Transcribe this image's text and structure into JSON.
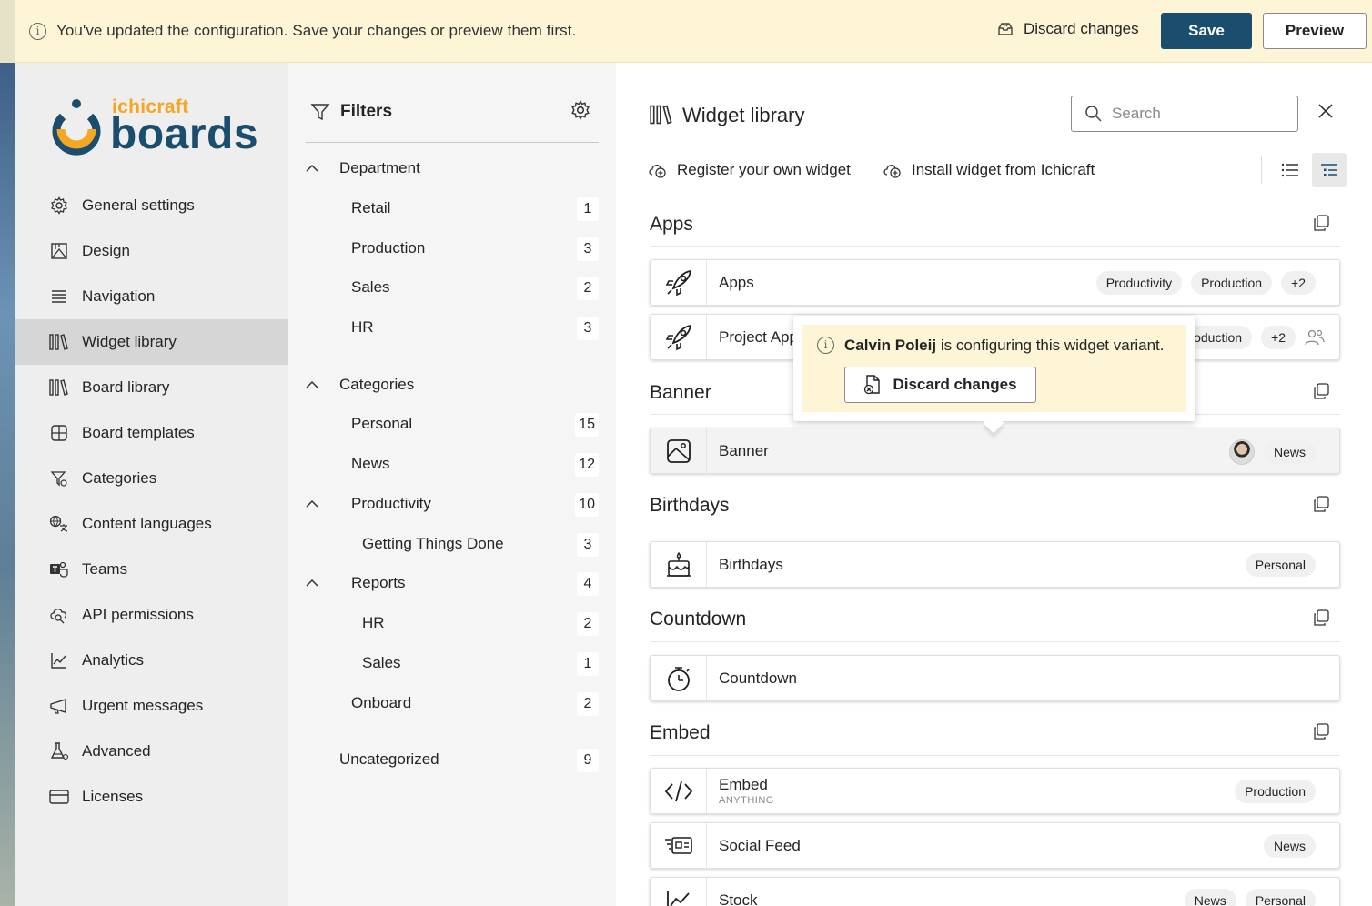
{
  "banner": {
    "message": "You've updated the configuration. Save your changes or preview them first.",
    "discard_label": "Discard changes",
    "save_label": "Save",
    "preview_label": "Preview"
  },
  "logo": {
    "small": "ichicraft",
    "big": "boards"
  },
  "sidebar": {
    "items": [
      {
        "label": "General settings",
        "icon": "gear-icon"
      },
      {
        "label": "Design",
        "icon": "design-icon"
      },
      {
        "label": "Navigation",
        "icon": "menu-icon"
      },
      {
        "label": "Widget library",
        "icon": "library-icon",
        "active": true
      },
      {
        "label": "Board library",
        "icon": "library-icon"
      },
      {
        "label": "Board templates",
        "icon": "template-icon"
      },
      {
        "label": "Categories",
        "icon": "filter-tag-icon"
      },
      {
        "label": "Content languages",
        "icon": "language-icon"
      },
      {
        "label": "Teams",
        "icon": "teams-icon"
      },
      {
        "label": "API permissions",
        "icon": "api-icon"
      },
      {
        "label": "Analytics",
        "icon": "chart-icon"
      },
      {
        "label": "Urgent messages",
        "icon": "megaphone-icon"
      },
      {
        "label": "Advanced",
        "icon": "flask-icon"
      },
      {
        "label": "Licenses",
        "icon": "card-icon"
      }
    ]
  },
  "filters": {
    "title": "Filters",
    "rows": [
      {
        "label": "Department",
        "count": ""
      },
      {
        "label": "Retail",
        "count": "1"
      },
      {
        "label": "Production",
        "count": "3"
      },
      {
        "label": "Sales",
        "count": "2"
      },
      {
        "label": "HR",
        "count": "3"
      },
      {
        "label": "Categories",
        "count": ""
      },
      {
        "label": "Personal",
        "count": "15"
      },
      {
        "label": "News",
        "count": "12"
      },
      {
        "label": "Productivity",
        "count": "10"
      },
      {
        "label": "Getting Things Done",
        "count": "3"
      },
      {
        "label": "Reports",
        "count": "4"
      },
      {
        "label": "HR",
        "count": "2"
      },
      {
        "label": "Sales",
        "count": "1"
      },
      {
        "label": "Onboard",
        "count": "2"
      },
      {
        "label": "Uncategorized",
        "count": "9"
      }
    ]
  },
  "main": {
    "title": "Widget library",
    "search_placeholder": "Search",
    "register_label": "Register your own widget",
    "install_label": "Install widget from Ichicraft",
    "sections": {
      "apps": "Apps",
      "banner": "Banner",
      "birthdays": "Birthdays",
      "countdown": "Countdown",
      "embed": "Embed"
    },
    "cards": {
      "apps": {
        "name": "Apps",
        "tags": [
          "Productivity",
          "Production",
          "+2"
        ]
      },
      "project_apps": {
        "name": "Project Apps",
        "tags": [
          "Production",
          "+2"
        ]
      },
      "banner": {
        "name": "Banner",
        "tags": [
          "News"
        ]
      },
      "birthdays": {
        "name": "Birthdays",
        "tags": [
          "Personal"
        ]
      },
      "countdown": {
        "name": "Countdown",
        "tags": []
      },
      "embed": {
        "name": "Embed",
        "sub": "ANYTHING",
        "tags": [
          "Production"
        ]
      },
      "social": {
        "name": "Social Feed",
        "tags": [
          "News"
        ]
      },
      "stock": {
        "name": "Stock",
        "tags": [
          "News",
          "Personal"
        ]
      }
    }
  },
  "popover": {
    "user": "Calvin Poleij",
    "text": " is configuring this widget variant.",
    "discard_label": "Discard changes"
  }
}
